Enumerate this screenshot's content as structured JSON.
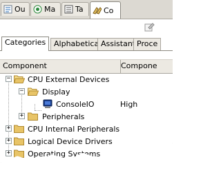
{
  "tabs": [
    {
      "label": "Ou",
      "icon": "outline-icon"
    },
    {
      "label": "Ma",
      "icon": "macro-icon"
    },
    {
      "label": "Ta",
      "icon": "tasks-icon"
    },
    {
      "label": "Co",
      "icon": "components-icon"
    }
  ],
  "subtabs": [
    "Categories",
    "Alphabetical",
    "Assistant",
    "Proce"
  ],
  "columns": {
    "component": "Component",
    "second": "Compone"
  },
  "tree": {
    "cpu_external": "CPU External Devices",
    "display": "Display",
    "consoleio": "ConsoleIO",
    "consoleio_level": "High",
    "peripherals": "Peripherals",
    "cpu_internal": "CPU Internal Peripherals",
    "logical_drivers": "Logical Device Drivers",
    "operating_systems": "Operating Systems"
  },
  "colors": {
    "folder": "#e8c467",
    "tab_bg": "#dcd9d2",
    "header_bg": "#ece9e2"
  }
}
